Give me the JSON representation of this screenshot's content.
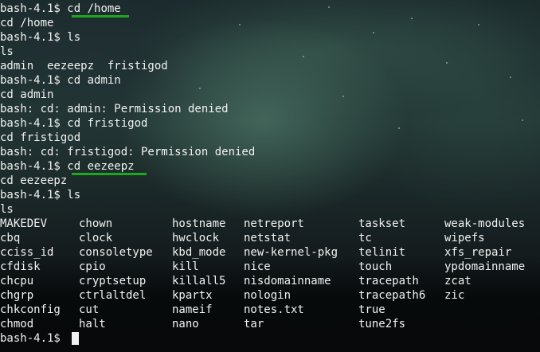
{
  "terminal": {
    "prompt": "bash-4.1$ ",
    "lines": [
      {
        "prompt": "bash-4.1$ ",
        "cmd": "cd /home"
      },
      {
        "text": "cd /home"
      },
      {
        "prompt": "bash-4.1$ ",
        "cmd": "ls"
      },
      {
        "text": "ls"
      },
      {
        "text": "admin  eezeepz  fristigod"
      },
      {
        "prompt": "bash-4.1$ ",
        "cmd": "cd admin"
      },
      {
        "text": "cd admin"
      },
      {
        "text": "bash: cd: admin: Permission denied"
      },
      {
        "prompt": "bash-4.1$ ",
        "cmd": "cd fristigod"
      },
      {
        "text": "cd fristigod"
      },
      {
        "text": "bash: cd: fristigod: Permission denied"
      },
      {
        "prompt": "bash-4.1$ ",
        "cmd": "cd eezeepz"
      },
      {
        "text": "cd eezeepz"
      },
      {
        "prompt": "bash-4.1$ ",
        "cmd": "ls"
      },
      {
        "text": "ls"
      }
    ],
    "listing": [
      [
        "MAKEDEV",
        "chown",
        "hostname",
        "netreport",
        "taskset",
        "weak-modules"
      ],
      [
        "cbq",
        "clock",
        "hwclock",
        "netstat",
        "tc",
        "wipefs"
      ],
      [
        "cciss_id",
        "consoletype",
        "kbd_mode",
        "new-kernel-pkg",
        "telinit",
        "xfs_repair"
      ],
      [
        "cfdisk",
        "cpio",
        "kill",
        "nice",
        "touch",
        "ypdomainname"
      ],
      [
        "chcpu",
        "cryptsetup",
        "killall5",
        "nisdomainname",
        "tracepath",
        "zcat"
      ],
      [
        "chgrp",
        "ctrlaltdel",
        "kpartx",
        "nologin",
        "tracepath6",
        "zic"
      ],
      [
        "chkconfig",
        "cut",
        "nameif",
        "notes.txt",
        "true",
        ""
      ],
      [
        "chmod",
        "halt",
        "nano",
        "tar",
        "tune2fs",
        ""
      ]
    ],
    "final_prompt": "bash-4.1$ "
  },
  "colors": {
    "text": "#f2f2f2",
    "highlight_underline": "#1fa81f"
  }
}
